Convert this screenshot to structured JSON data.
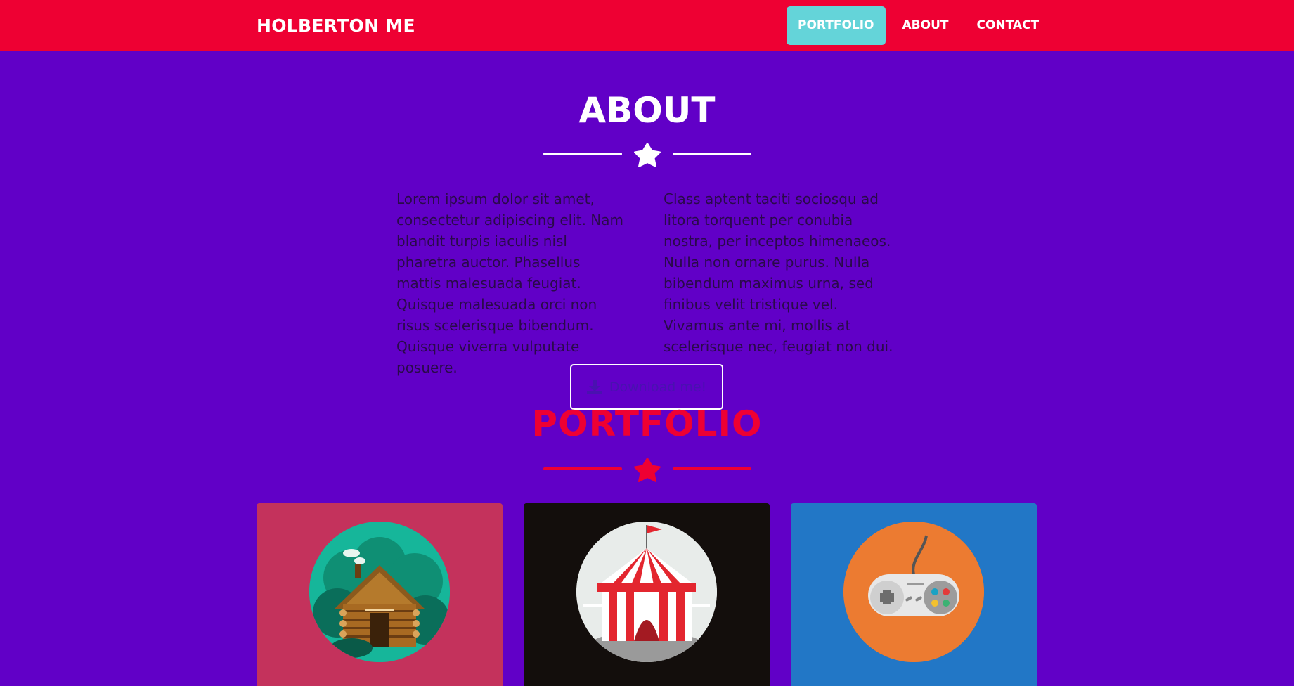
{
  "navbar": {
    "brand": "HOLBERTON ME",
    "items": [
      {
        "label": "PORTFOLIO",
        "active": true
      },
      {
        "label": "ABOUT",
        "active": false
      },
      {
        "label": "CONTACT",
        "active": false
      }
    ]
  },
  "about": {
    "title": "ABOUT",
    "col1": "Lorem ipsum dolor sit amet, consectetur adipiscing elit. Nam blandit turpis iaculis nisl pharetra auctor. Phasellus mattis malesuada feugiat. Quisque malesuada orci non risus scelerisque bibendum. Quisque viverra vulputate posuere.",
    "col2": "Class aptent taciti sociosqu ad litora torquent per conubia nostra, per inceptos himenaeos. Nulla non ornare purus. Nulla bibendum maximus urna, sed finibus velit tristique vel. Vivamus ante mi, mollis at scelerisque nec, feugiat non dui.",
    "download_label": "Download me!"
  },
  "portfolio": {
    "title": "PORTFOLIO",
    "cards": [
      {
        "image": "log-cabin",
        "bg": "#c4325c",
        "circle": "#16b69a"
      },
      {
        "image": "circus-tent",
        "bg": "#130e0c",
        "circle": "#e8ecea"
      },
      {
        "image": "game-controller",
        "bg": "#2277c6",
        "circle": "#ec7b31"
      }
    ]
  },
  "colors": {
    "navbar": "#ee0033",
    "page_bg": "#6100c7",
    "active_nav": "#64d4d9",
    "portfolio_accent": "#ee0033"
  }
}
